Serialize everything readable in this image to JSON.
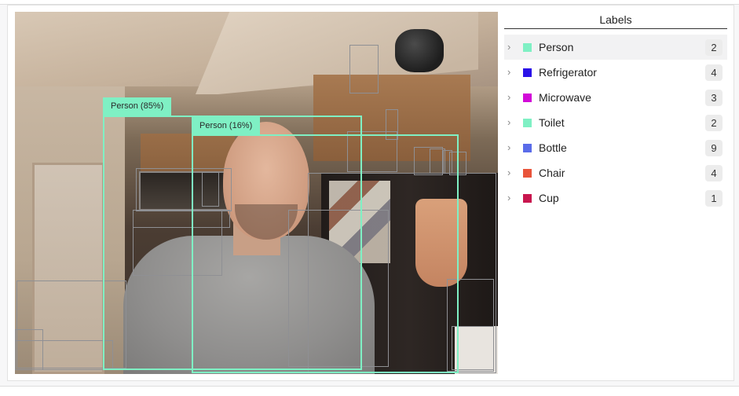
{
  "labels_panel": {
    "title": "Labels",
    "items": [
      {
        "label": "Person",
        "count": "2",
        "color": "#7ff0c4",
        "active": true
      },
      {
        "label": "Refrigerator",
        "count": "4",
        "color": "#2a12e8",
        "active": false
      },
      {
        "label": "Microwave",
        "count": "3",
        "color": "#d20ad8",
        "active": false
      },
      {
        "label": "Toilet",
        "count": "2",
        "color": "#7ff0c4",
        "active": false
      },
      {
        "label": "Bottle",
        "count": "9",
        "color": "#5a6ce9",
        "active": false
      },
      {
        "label": "Chair",
        "count": "4",
        "color": "#e9543a",
        "active": false
      },
      {
        "label": "Cup",
        "count": "1",
        "color": "#c8164e",
        "active": false
      }
    ]
  },
  "detections": {
    "person_1_tag": "Person (85%)",
    "person_2_tag": "Person (16%)"
  },
  "colors": {
    "person_box": "#7ff0c4",
    "other_box": "#8f9094"
  }
}
